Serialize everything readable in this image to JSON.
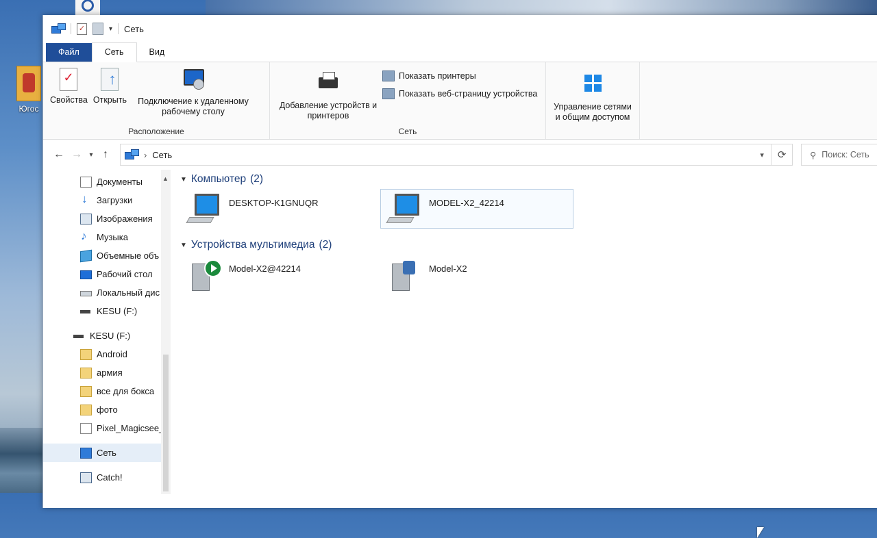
{
  "window": {
    "title": "Сеть"
  },
  "ribbon_tabs": [
    {
      "label": "Файл"
    },
    {
      "label": "Сеть"
    },
    {
      "label": "Вид"
    }
  ],
  "ribbon": {
    "location_group": {
      "label": "Расположение",
      "properties": "Свойства",
      "open": "Открыть",
      "remote_desktop": "Подключение к удаленному рабочему столу"
    },
    "network_group": {
      "label": "Сеть",
      "add_devices": "Добавление устройств и принтеров",
      "show_printers": "Показать принтеры",
      "show_device_page": "Показать веб-страницу устройства"
    },
    "sharing": "Управление сетями и общим доступом"
  },
  "address": {
    "crumb": "Сеть"
  },
  "search": {
    "placeholder": "Поиск: Сеть"
  },
  "desktop": {
    "icon_label": "Югос"
  },
  "nav": [
    {
      "label": "Документы",
      "icon": "documents-icon"
    },
    {
      "label": "Загрузки",
      "icon": "downloads-icon"
    },
    {
      "label": "Изображения",
      "icon": "images-icon"
    },
    {
      "label": "Музыка",
      "icon": "music-icon"
    },
    {
      "label": "Объемные объ",
      "icon": "3d-objects-icon"
    },
    {
      "label": "Рабочий стол",
      "icon": "desktop-icon"
    },
    {
      "label": "Локальный дис",
      "icon": "local-disk-icon"
    },
    {
      "label": "KESU (F:)",
      "icon": "usb-drive-icon"
    },
    {
      "label": "KESU (F:)",
      "icon": "usb-drive-icon"
    },
    {
      "label": "Android",
      "icon": "folder-icon"
    },
    {
      "label": "армия",
      "icon": "folder-icon"
    },
    {
      "label": "все для бокса",
      "icon": "folder-icon"
    },
    {
      "label": "фото",
      "icon": "folder-icon"
    },
    {
      "label": "Pixel_Magicsee_",
      "icon": "file-icon"
    },
    {
      "label": "Сеть",
      "icon": "network-icon"
    },
    {
      "label": "Catch!",
      "icon": "catch-icon"
    }
  ],
  "sections": [
    {
      "title": "Компьютер",
      "count": "(2)",
      "items": [
        {
          "name": "DESKTOP-K1GNUQR",
          "icon": "computer-icon"
        },
        {
          "name": "MODEL-X2_42214",
          "icon": "computer-icon"
        }
      ]
    },
    {
      "title": "Устройства мультимедиа",
      "count": "(2)",
      "items": [
        {
          "name": "Model-X2@42214",
          "icon": "media-player-icon"
        },
        {
          "name": "Model-X2",
          "icon": "media-device-icon"
        }
      ]
    }
  ]
}
